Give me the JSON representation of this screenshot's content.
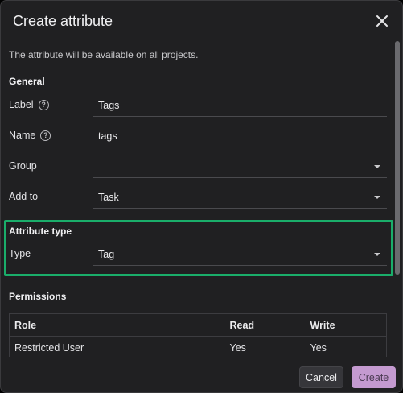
{
  "dialog": {
    "title": "Create attribute",
    "description": "The attribute will be available on all projects."
  },
  "general": {
    "heading": "General",
    "label_label": "Label",
    "label_value": "Tags",
    "name_label": "Name",
    "name_value": "tags",
    "group_label": "Group",
    "group_value": "",
    "addto_label": "Add to",
    "addto_value": "Task"
  },
  "attribute_type": {
    "heading": "Attribute type",
    "type_label": "Type",
    "type_value": "Tag"
  },
  "permissions": {
    "heading": "Permissions",
    "columns": [
      "Role",
      "Read",
      "Write"
    ],
    "rows": [
      {
        "role": "Restricted User",
        "read": "Yes",
        "write": "Yes"
      }
    ]
  },
  "footer": {
    "cancel": "Cancel",
    "create": "Create"
  },
  "colors": {
    "highlight": "#1aad6a",
    "primary_button": "#c49ad0",
    "background": "#202022"
  },
  "icons": {
    "close": "close-icon",
    "help": "help-circle-icon",
    "dropdown": "chevron-down-icon"
  }
}
